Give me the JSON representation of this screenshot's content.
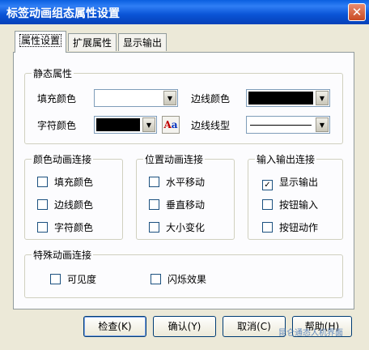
{
  "window": {
    "title": "标签动画组态属性设置",
    "close_glyph": "✕"
  },
  "tabs": [
    {
      "label": "属性设置"
    },
    {
      "label": "扩展属性"
    },
    {
      "label": "显示输出"
    }
  ],
  "static_props": {
    "legend": "静态属性",
    "fill_color_label": "填充颜色",
    "border_color_label": "边线颜色",
    "text_color_label": "字符颜色",
    "border_style_label": "边线线型",
    "fill_color": "#ffffff",
    "border_color": "#000000",
    "text_color": "#000000",
    "font_button_glyph_upper": "A",
    "font_button_glyph_lower": "a"
  },
  "color_anim": {
    "legend": "颜色动画连接",
    "items": [
      {
        "label": "填充颜色",
        "checked": false
      },
      {
        "label": "边线颜色",
        "checked": false
      },
      {
        "label": "字符颜色",
        "checked": false
      }
    ]
  },
  "pos_anim": {
    "legend": "位置动画连接",
    "items": [
      {
        "label": "水平移动",
        "checked": false
      },
      {
        "label": "垂直移动",
        "checked": false
      },
      {
        "label": "大小变化",
        "checked": false
      }
    ]
  },
  "io": {
    "legend": "输入输出连接",
    "items": [
      {
        "label": "显示输出",
        "checked": true
      },
      {
        "label": "按钮输入",
        "checked": false
      },
      {
        "label": "按钮动作",
        "checked": false
      }
    ]
  },
  "special": {
    "legend": "特殊动画连接",
    "items": [
      {
        "label": "可见度",
        "checked": false
      },
      {
        "label": "闪烁效果",
        "checked": false
      }
    ]
  },
  "buttons": {
    "check": "检查(K)",
    "ok": "确认(Y)",
    "cancel": "取消(C)",
    "help": "帮助(H)"
  },
  "watermark": "昆仑通态人机界面",
  "checkmark": "✓",
  "dropdown_glyph": "▼"
}
